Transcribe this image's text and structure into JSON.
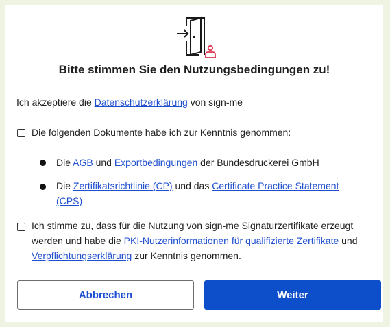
{
  "dialog": {
    "title": "Bitte stimmen Sie den Nutzungsbedingungen zu!",
    "accept_prefix": "Ich akzeptiere die ",
    "accept_link": "Datenschutzerklärung",
    "accept_suffix": " von sign-me",
    "checkbox1": {
      "checked": false,
      "label": "Die folgenden Dokumente habe ich zur Kenntnis genommen:"
    },
    "bullet1": {
      "prefix": "Die ",
      "link1": "AGB",
      "mid": " und ",
      "link2": "Exportbedingungen",
      "suffix": " der Bundesdruckerei GmbH"
    },
    "bullet2": {
      "prefix": "Die ",
      "link1": "Zertifikatsrichtlinie (CP)",
      "mid": " und das ",
      "link2": "Certificate Practice Statement (CPS)"
    },
    "checkbox2": {
      "checked": false,
      "prefix": "Ich stimme zu, dass für die Nutzung von sign-me Signaturzertifikate erzeugt werden und habe die ",
      "link1": "PKI-Nutzerinformationen für qualifizierte Zertifikate ",
      "mid": "und ",
      "link2": "Verpflichtungserklärung",
      "suffix": " zur Kenntnis genommen."
    },
    "buttons": {
      "cancel": "Abbrechen",
      "next": "Weiter"
    }
  },
  "colors": {
    "link": "#1f4fd1",
    "primary": "#0d4fcb",
    "icon_accent": "#e0334f",
    "page_bg": "#eef3e2"
  },
  "icons": [
    "door-enter-icon",
    "person-icon"
  ]
}
